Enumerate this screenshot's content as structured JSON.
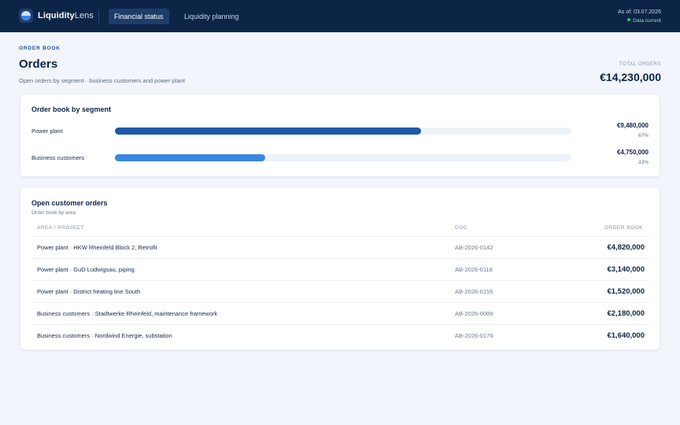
{
  "header": {
    "brand_bold": "Liquidity",
    "brand_light": "Lens",
    "tabs": [
      {
        "label": "Financial status",
        "active": true
      },
      {
        "label": "Liquidity planning",
        "active": false
      }
    ],
    "as_of": "As of: 03.07.2026",
    "status": "Data current",
    "status_color": "#2fbf71"
  },
  "page": {
    "eyebrow": "ORDER BOOK",
    "title": "Orders",
    "subtitle": "Open orders by segment · business customers and power plant",
    "total_label": "TOTAL ORDERS",
    "total_value": "€14,230,000"
  },
  "segments": {
    "title": "Order book by segment",
    "items": [
      {
        "label": "Power plant",
        "amount": "€9,480,000",
        "percent_label": "67%",
        "share": 0.67,
        "color": "#1d5aa8"
      },
      {
        "label": "Business customers",
        "amount": "€4,750,000",
        "percent_label": "33%",
        "share": 0.33,
        "color": "#3a86e0"
      }
    ]
  },
  "orders": {
    "title": "Open customer orders",
    "subtitle": "Order book by area",
    "columns": {
      "area": "AREA / PROJECT",
      "doc": "DOC",
      "amount": "ORDER BOOK"
    },
    "rows": [
      {
        "area": "Power plant · HKW Rheinfeld Block 2, Retrofit",
        "doc": "AB-2026-0142",
        "amount": "€4,820,000"
      },
      {
        "area": "Power plant · GuD Ludwigsau, piping",
        "doc": "AB-2026-0118",
        "amount": "€3,140,000"
      },
      {
        "area": "Power plant · District heating line South",
        "doc": "AB-2026-0155",
        "amount": "€1,520,000"
      },
      {
        "area": "Business customers · Stadtwerke Rheinfeld, maintenance framework",
        "doc": "AB-2026-0089",
        "amount": "€2,180,000"
      },
      {
        "area": "Business customers · Nordwind Energie, substation",
        "doc": "AB-2026-0176",
        "amount": "€1,640,000"
      }
    ]
  }
}
